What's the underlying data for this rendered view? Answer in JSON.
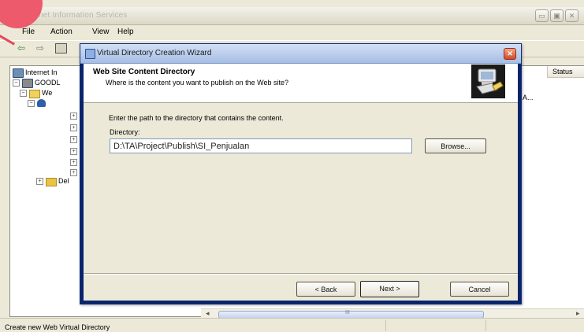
{
  "main_window": {
    "title": "Internet Information Services",
    "controls": {
      "minimize": "▭",
      "maximize": "▣",
      "close": "✕"
    },
    "menu": [
      "File",
      "Action",
      "View",
      "Help"
    ],
    "toolbar": {
      "back": "⇦",
      "forward": "⇨"
    },
    "tree": {
      "root": "Internet In",
      "computer": "GOODL",
      "web_sites": "We",
      "bottom_item": "Del",
      "expand_glyph": "+",
      "collapse_glyph": "−"
    },
    "list": {
      "status_column": "Status",
      "partial_row": "A..."
    },
    "scrollbar": {
      "left_arrow": "◂",
      "right_arrow": "▸",
      "thumb_grip": "III"
    },
    "status_bar": "Create new Web Virtual Directory"
  },
  "wizard": {
    "title": "Virtual Directory Creation Wizard",
    "close": "✕",
    "heading": "Web Site Content Directory",
    "subheading": "Where is the content you want to publish on the Web site?",
    "instruction": "Enter the path to the directory that contains the content.",
    "directory_label": "Directory:",
    "directory_value": "D:\\TA\\Project\\Publish\\SI_Penjualan",
    "browse_label": "Browse...",
    "back_label": "< Back",
    "next_label": "Next >",
    "cancel_label": "Cancel"
  },
  "icons": {
    "window": "iis-icon",
    "wizard": "wizard-icon",
    "header_graphic": "pc-with-folder-icon",
    "accent_color": "#0b2c7d"
  }
}
